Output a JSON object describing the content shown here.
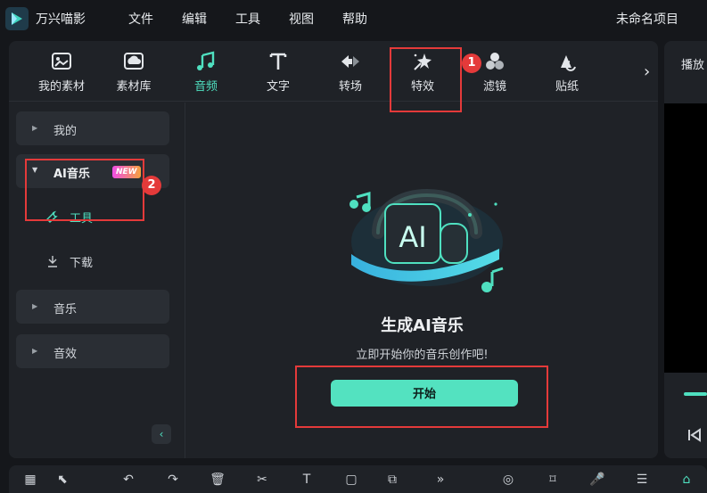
{
  "app": {
    "name": "万兴喵影",
    "project_title": "未命名项目"
  },
  "menu": [
    "文件",
    "编辑",
    "工具",
    "视图",
    "帮助"
  ],
  "toolbar": {
    "items": [
      {
        "label": "我的素材",
        "icon": "my-assets-icon"
      },
      {
        "label": "素材库",
        "icon": "library-icon"
      },
      {
        "label": "音频",
        "icon": "music-note-icon",
        "active": true
      },
      {
        "label": "文字",
        "icon": "text-icon"
      },
      {
        "label": "转场",
        "icon": "transition-icon"
      },
      {
        "label": "特效",
        "icon": "effects-icon"
      },
      {
        "label": "滤镜",
        "icon": "filter-icon"
      },
      {
        "label": "贴纸",
        "icon": "sticker-icon"
      }
    ],
    "more": "›"
  },
  "sidebar": {
    "mine": "我的",
    "ai_music": "AI音乐",
    "new_badge": "NEW",
    "tools": "工具",
    "download": "下载",
    "music": "音乐",
    "sound_effects": "音效"
  },
  "main": {
    "illustration_text": "AI",
    "title": "生成AI音乐",
    "subtitle": "立即开始你的音乐创作吧!",
    "start_button": "开始"
  },
  "preview": {
    "tab": "播放"
  },
  "annotations": {
    "first": "1",
    "second": "2"
  },
  "colors": {
    "accent": "#4fe0c0",
    "annotation": "#e43a3a",
    "button": "#53e2c0"
  }
}
